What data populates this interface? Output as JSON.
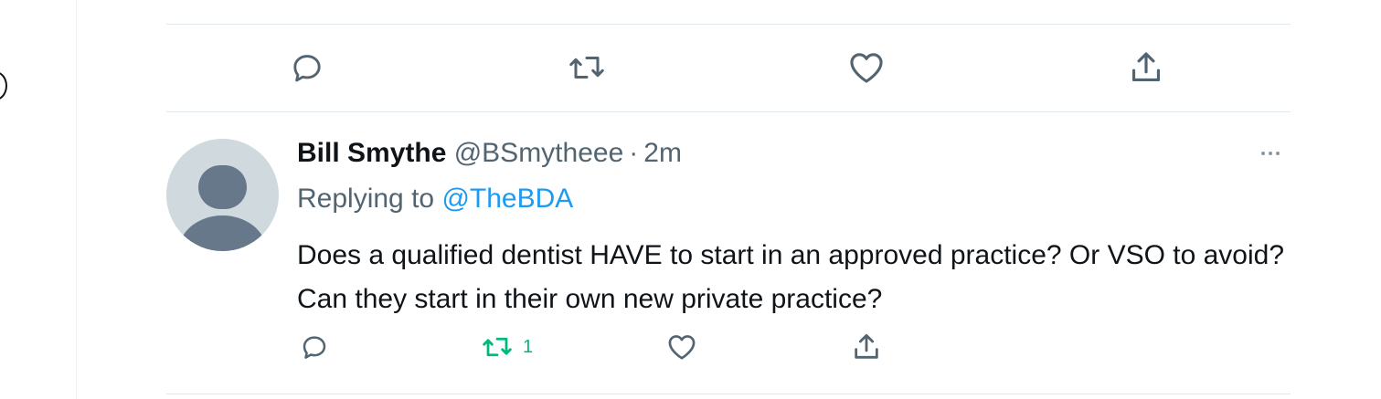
{
  "tweet": {
    "author_name": "Bill Smythe",
    "author_handle": "@BSmytheee",
    "separator": "·",
    "time": "2m",
    "replying_prefix": "Replying to",
    "replying_to": "@TheBDA",
    "text": "Does a qualified dentist HAVE to start in an approved practice? Or VSO to avoid? Can they start in their own new private practice?",
    "retweet_count": "1"
  },
  "colors": {
    "retweeted": "#00ba7c",
    "link": "#1d9bf0",
    "icon": "#536471"
  }
}
